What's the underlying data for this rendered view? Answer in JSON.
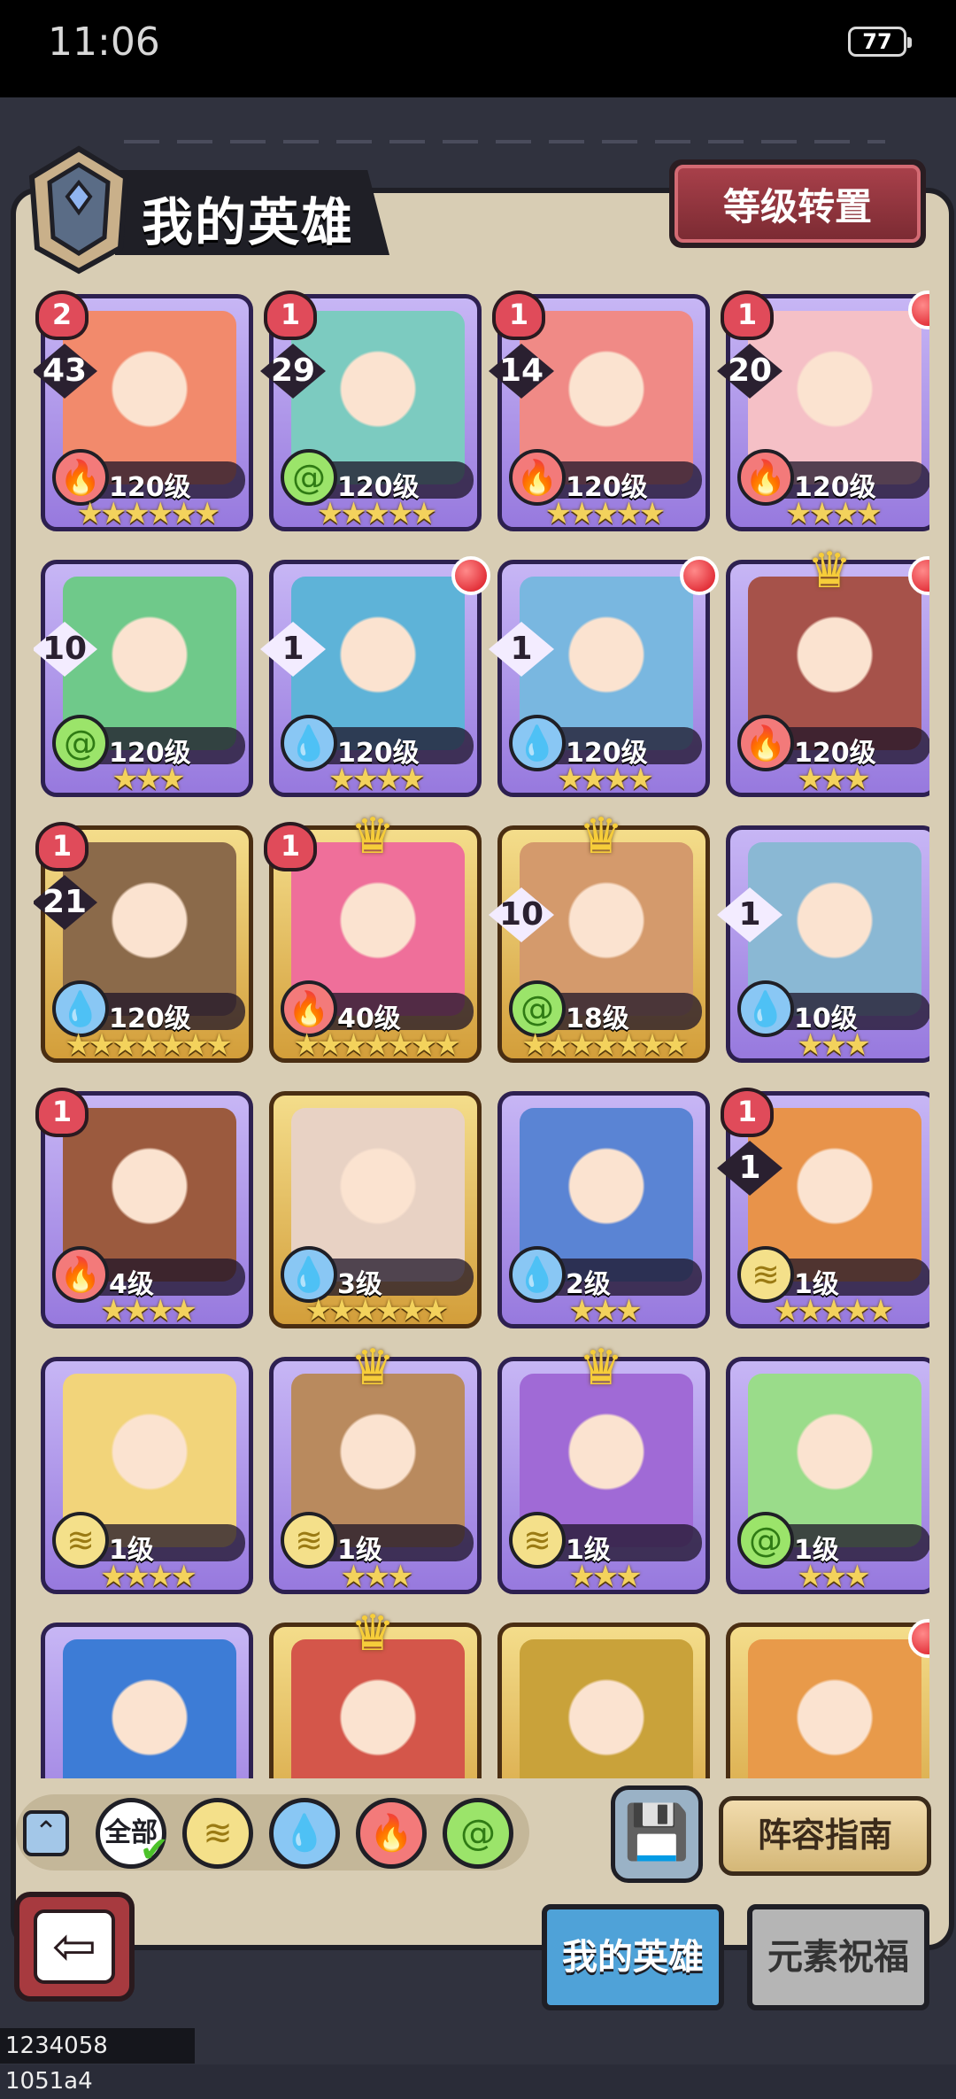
{
  "status_bar": {
    "time": "11:06",
    "battery": "77"
  },
  "header": {
    "title": "我的英雄",
    "level_transfer_button": "等级转置"
  },
  "heroes": [
    {
      "rank": "2",
      "count": "43",
      "element": "fire",
      "level": "120级",
      "stars": 6,
      "frame": "purple",
      "portrait_color": "#f28a6c",
      "crown": false,
      "red_dot": false
    },
    {
      "rank": "1",
      "count": "29",
      "element": "wind",
      "level": "120级",
      "stars": 5,
      "frame": "purple",
      "portrait_color": "#7ccbc0",
      "crown": false,
      "red_dot": false
    },
    {
      "rank": "1",
      "count": "14",
      "element": "fire",
      "level": "120级",
      "stars": 5,
      "frame": "purple",
      "portrait_color": "#f08a86",
      "crown": false,
      "red_dot": false
    },
    {
      "rank": "1",
      "count": "20",
      "element": "fire",
      "level": "120级",
      "stars": 4,
      "frame": "purple",
      "portrait_color": "#f5c0c6",
      "crown": false,
      "red_dot": true
    },
    {
      "rank": "",
      "count": "10",
      "element": "wind",
      "level": "120级",
      "stars": 3,
      "frame": "purple",
      "portrait_color": "#6fc98a",
      "crown": false,
      "red_dot": false
    },
    {
      "rank": "",
      "count": "1",
      "element": "water",
      "level": "120级",
      "stars": 4,
      "frame": "purple",
      "portrait_color": "#5eb3d8",
      "crown": false,
      "red_dot": true
    },
    {
      "rank": "",
      "count": "1",
      "element": "water",
      "level": "120级",
      "stars": 4,
      "frame": "purple",
      "portrait_color": "#79b7e0",
      "crown": false,
      "red_dot": true
    },
    {
      "rank": "",
      "count": "",
      "element": "fire",
      "level": "120级",
      "stars": 3,
      "frame": "purple",
      "portrait_color": "#a6524a",
      "crown": true,
      "red_dot": true
    },
    {
      "rank": "1",
      "count": "21",
      "element": "water",
      "level": "120级",
      "stars": 7,
      "frame": "gold",
      "portrait_color": "#8b6a4a",
      "crown": false,
      "red_dot": false
    },
    {
      "rank": "1",
      "count": "",
      "element": "fire",
      "level": "40级",
      "stars": 7,
      "frame": "gold",
      "portrait_color": "#ef6f9a",
      "crown": true,
      "red_dot": false
    },
    {
      "rank": "",
      "count": "10",
      "element": "wind",
      "level": "18级",
      "stars": 7,
      "frame": "gold",
      "portrait_color": "#d49a6c",
      "crown": true,
      "red_dot": false
    },
    {
      "rank": "",
      "count": "1",
      "element": "water",
      "level": "10级",
      "stars": 3,
      "frame": "purple",
      "portrait_color": "#8ab8d4",
      "crown": false,
      "red_dot": false
    },
    {
      "rank": "1",
      "count": "",
      "element": "fire",
      "level": "4级",
      "stars": 4,
      "frame": "purple",
      "portrait_color": "#9b5a3e",
      "crown": false,
      "red_dot": false
    },
    {
      "rank": "",
      "count": "",
      "element": "water",
      "level": "3级",
      "stars": 6,
      "frame": "gold",
      "portrait_color": "#e8d2c4",
      "crown": false,
      "red_dot": false
    },
    {
      "rank": "",
      "count": "",
      "element": "water",
      "level": "2级",
      "stars": 3,
      "frame": "purple",
      "portrait_color": "#5a84d4",
      "crown": false,
      "red_dot": false
    },
    {
      "rank": "1",
      "count": "1",
      "element": "earth",
      "level": "1级",
      "stars": 5,
      "frame": "purple",
      "portrait_color": "#e8934a",
      "crown": false,
      "red_dot": false
    },
    {
      "rank": "",
      "count": "",
      "element": "earth",
      "level": "1级",
      "stars": 4,
      "frame": "purple",
      "portrait_color": "#f2d47a",
      "crown": false,
      "red_dot": false
    },
    {
      "rank": "",
      "count": "",
      "element": "earth",
      "level": "1级",
      "stars": 3,
      "frame": "purple",
      "portrait_color": "#b98a5e",
      "crown": true,
      "red_dot": false
    },
    {
      "rank": "",
      "count": "",
      "element": "earth",
      "level": "1级",
      "stars": 3,
      "frame": "purple",
      "portrait_color": "#a06ad6",
      "crown": true,
      "red_dot": false
    },
    {
      "rank": "",
      "count": "",
      "element": "wind",
      "level": "1级",
      "stars": 3,
      "frame": "purple",
      "portrait_color": "#9adc8a",
      "crown": false,
      "red_dot": false
    },
    {
      "rank": "",
      "count": "",
      "element": "",
      "level": "",
      "stars": 0,
      "frame": "purple",
      "portrait_color": "#3d7cd6",
      "crown": false,
      "red_dot": false
    },
    {
      "rank": "",
      "count": "",
      "element": "",
      "level": "",
      "stars": 0,
      "frame": "gold",
      "portrait_color": "#d4564a",
      "crown": true,
      "red_dot": false
    },
    {
      "rank": "",
      "count": "",
      "element": "",
      "level": "",
      "stars": 0,
      "frame": "gold",
      "portrait_color": "#c9a23a",
      "crown": false,
      "red_dot": false
    },
    {
      "rank": "",
      "count": "",
      "element": "",
      "level": "",
      "stars": 0,
      "frame": "gold",
      "portrait_color": "#e89a4a",
      "crown": false,
      "red_dot": true
    }
  ],
  "filters": {
    "all_label": "全部",
    "selected": "all",
    "icons": [
      "earth-icon",
      "water-icon",
      "fire-icon",
      "wind-icon"
    ]
  },
  "lineup_guide_button": "阵容指南",
  "tabs": {
    "my_heroes": "我的英雄",
    "element_blessing": "元素祝福"
  },
  "build_id": "1234058 1051a4",
  "colors": {
    "fire": "#f37a7a",
    "wind": "#9be46a",
    "water": "#89c7f4",
    "earth": "#f4e08a"
  }
}
